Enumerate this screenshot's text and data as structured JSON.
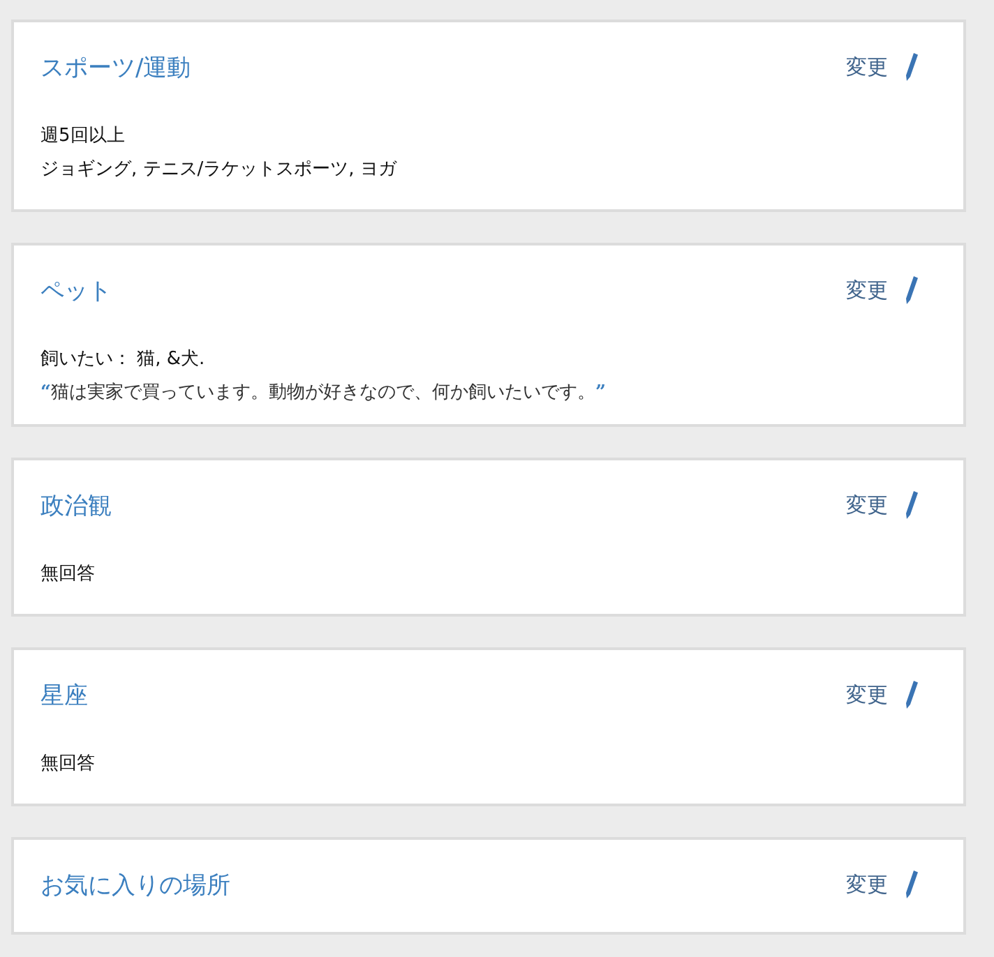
{
  "sections": [
    {
      "title": "スポーツ/運動",
      "edit_label": "変更",
      "lines": [
        {
          "kind": "text",
          "text": "週5回以上"
        },
        {
          "kind": "text",
          "text": "ジョギング, テニス/ラケットスポーツ, ヨガ"
        }
      ]
    },
    {
      "title": "ペット",
      "edit_label": "変更",
      "lines": [
        {
          "kind": "text",
          "text": "飼いたい： 猫, &犬."
        },
        {
          "kind": "quote",
          "open": "“",
          "text": "猫は実家で買っています。動物が好きなので、何か飼いたいです。",
          "close": "”"
        }
      ]
    },
    {
      "title": "政治観",
      "edit_label": "変更",
      "lines": [
        {
          "kind": "text",
          "text": "無回答"
        }
      ]
    },
    {
      "title": "星座",
      "edit_label": "変更",
      "lines": [
        {
          "kind": "text",
          "text": "無回答"
        }
      ]
    },
    {
      "title": "お気に入りの場所",
      "edit_label": "変更"
    }
  ]
}
